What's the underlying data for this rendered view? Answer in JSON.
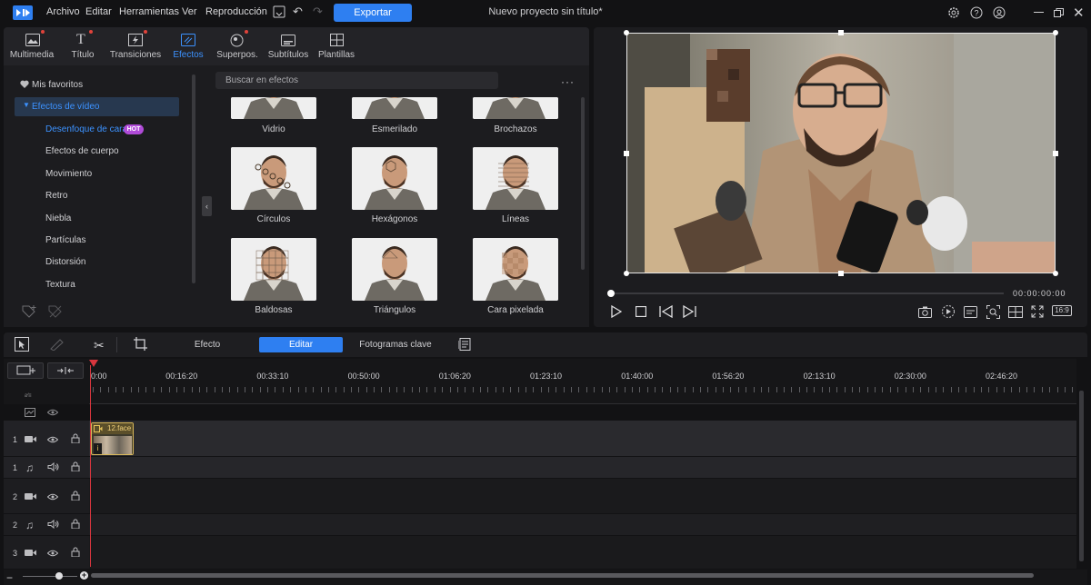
{
  "app": {
    "menu": [
      "Archivo",
      "Editar",
      "Herramientas",
      "Ver",
      "Reproducción"
    ],
    "export_label": "Exportar",
    "project_title": "Nuevo proyecto sin título*"
  },
  "library": {
    "tabs": [
      {
        "label": "Multimedia",
        "icon": "media-icon",
        "dot": true
      },
      {
        "label": "Título",
        "icon": "title-icon",
        "dot": true
      },
      {
        "label": "Transiciones",
        "icon": "transition-icon",
        "dot": true
      },
      {
        "label": "Efectos",
        "icon": "effects-icon",
        "dot": false,
        "active": true
      },
      {
        "label": "Superpos.",
        "icon": "overlay-icon",
        "dot": true
      },
      {
        "label": "Subtítulos",
        "icon": "subtitles-icon",
        "dot": false
      },
      {
        "label": "Plantillas",
        "icon": "templates-icon",
        "dot": false
      }
    ],
    "favorites_label": "Mis favoritos",
    "video_effects_label": "Efectos de vídeo",
    "categories": [
      "Desenfoque de cara",
      "Efectos de cuerpo",
      "Movimiento",
      "Retro",
      "Niebla",
      "Partículas",
      "Distorsión",
      "Textura"
    ],
    "hot_badge": "HOT",
    "search_placeholder": "Buscar en efectos",
    "effects_partial": [
      "Vidrio",
      "Esmerilado",
      "Brochazos"
    ],
    "effects": [
      "Círculos",
      "Hexágonos",
      "Líneas",
      "Baldosas",
      "Triángulos",
      "Cara pixelada"
    ]
  },
  "preview": {
    "timecode": "00:00:00:00",
    "aspect_label": "16:9"
  },
  "timeline": {
    "tabs": [
      "Efecto",
      "Editar",
      "Fotogramas clave"
    ],
    "active_tab": "Editar",
    "ruler": [
      "0:00",
      "00:16:20",
      "00:33:10",
      "00:50:00",
      "01:06:20",
      "01:23:10",
      "01:40:00",
      "01:56:20",
      "02:13:10",
      "02:30:00",
      "02:46:20"
    ],
    "clip_name": "12.face",
    "track_numbers": [
      "1",
      "1",
      "2",
      "2",
      "3"
    ]
  },
  "colors": {
    "accent": "#2e7ff1",
    "hot": "#b04bd8",
    "active_tab": "#3c92ff",
    "playhead": "#d9363e"
  }
}
